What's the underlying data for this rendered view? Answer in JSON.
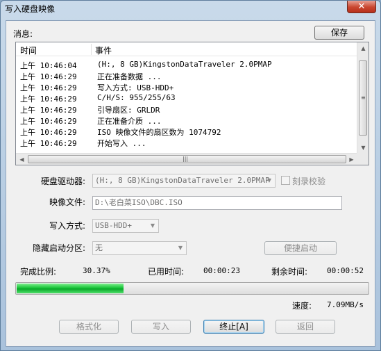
{
  "window": {
    "title": "写入硬盘映像",
    "close_glyph": "✕"
  },
  "messages": {
    "label": "消息:",
    "save_label": "保存"
  },
  "log": {
    "columns": {
      "time": "时间",
      "event": "事件"
    },
    "rows": [
      {
        "ampm": "上午",
        "time": "10:46:04",
        "event": "(H:, 8 GB)KingstonDataTraveler 2.0PMAP"
      },
      {
        "ampm": "上午",
        "time": "10:46:29",
        "event": "正在准备数据 ..."
      },
      {
        "ampm": "上午",
        "time": "10:46:29",
        "event": "写入方式: USB-HDD+"
      },
      {
        "ampm": "上午",
        "time": "10:46:29",
        "event": "C/H/S: 955/255/63"
      },
      {
        "ampm": "上午",
        "time": "10:46:29",
        "event": "引导扇区: GRLDR"
      },
      {
        "ampm": "上午",
        "time": "10:46:29",
        "event": "正在准备介质 ..."
      },
      {
        "ampm": "上午",
        "time": "10:46:29",
        "event": "ISO 映像文件的扇区数为 1074792"
      },
      {
        "ampm": "上午",
        "time": "10:46:29",
        "event": "开始写入 ..."
      }
    ]
  },
  "form": {
    "drive_label": "硬盘驱动器:",
    "drive_value": "(H:, 8 GB)KingstonDataTraveler 2.0PMAP",
    "verify_label": "刻录校验",
    "image_label": "映像文件:",
    "image_value": "D:\\老白菜ISO\\DBC.ISO",
    "write_mode_label": "写入方式:",
    "write_mode_value": "USB-HDD+",
    "hidden_part_label": "隐藏启动分区:",
    "hidden_part_value": "无",
    "quick_boot_label": "便捷启动"
  },
  "status": {
    "complete_label": "完成比例:",
    "complete_value": "30.37%",
    "progress_fraction": 0.3037,
    "elapsed_label": "已用时间:",
    "elapsed_value": "00:00:23",
    "remaining_label": "剩余时间:",
    "remaining_value": "00:00:52",
    "speed_label": "速度:",
    "speed_value": "7.09MB/s"
  },
  "buttons": {
    "format": "格式化",
    "write": "写入",
    "stop": "终止[A]",
    "back": "返回"
  }
}
